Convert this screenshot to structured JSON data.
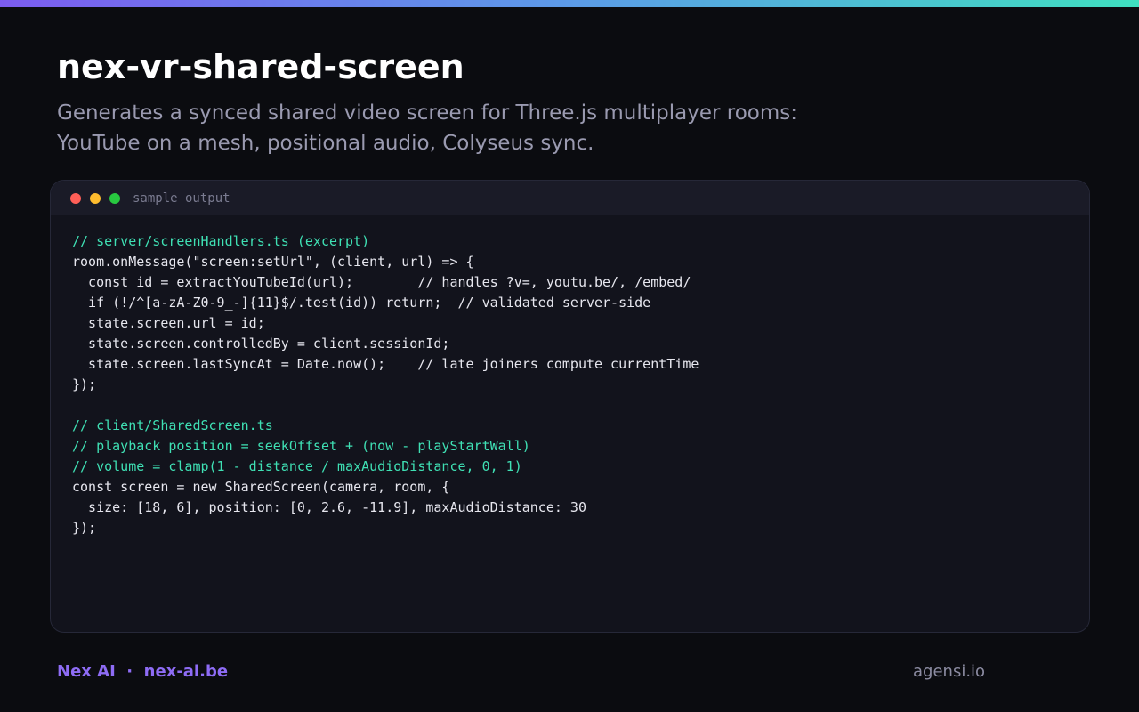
{
  "header": {
    "title": "nex-vr-shared-screen",
    "subtitle_line1": "Generates a synced shared video screen for Three.js multiplayer rooms:",
    "subtitle_line2": "YouTube on a mesh, positional audio, Colyseus sync."
  },
  "window": {
    "title": "sample output",
    "lines": [
      {
        "text": "// server/screenHandlers.ts (excerpt)",
        "kind": "comment"
      },
      {
        "text": "room.onMessage(\"screen:setUrl\", (client, url) => {",
        "kind": "code"
      },
      {
        "text": "  const id = extractYouTubeId(url);        // handles ?v=, youtu.be/, /embed/",
        "kind": "code"
      },
      {
        "text": "  if (!/^[a-zA-Z0-9_-]{11}$/.test(id)) return;  // validated server-side",
        "kind": "code"
      },
      {
        "text": "  state.screen.url = id;",
        "kind": "code"
      },
      {
        "text": "  state.screen.controlledBy = client.sessionId;",
        "kind": "code"
      },
      {
        "text": "  state.screen.lastSyncAt = Date.now();    // late joiners compute currentTime",
        "kind": "code"
      },
      {
        "text": "});",
        "kind": "code"
      },
      {
        "text": "",
        "kind": "code"
      },
      {
        "text": "// client/SharedScreen.ts",
        "kind": "comment"
      },
      {
        "text": "// playback position = seekOffset + (now - playStartWall)",
        "kind": "comment"
      },
      {
        "text": "// volume = clamp(1 - distance / maxAudioDistance, 0, 1)",
        "kind": "comment"
      },
      {
        "text": "const screen = new SharedScreen(camera, room, {",
        "kind": "code"
      },
      {
        "text": "  size: [18, 6], position: [0, 2.6, -11.9], maxAudioDistance: 30",
        "kind": "code"
      },
      {
        "text": "});",
        "kind": "code"
      }
    ]
  },
  "footer": {
    "brand": "Nex AI  ·  nex-ai.be",
    "site": "agensi.io"
  },
  "colors": {
    "accent": "#8e6cf5",
    "comment": "#3fe0b4",
    "background": "#0b0c10"
  }
}
